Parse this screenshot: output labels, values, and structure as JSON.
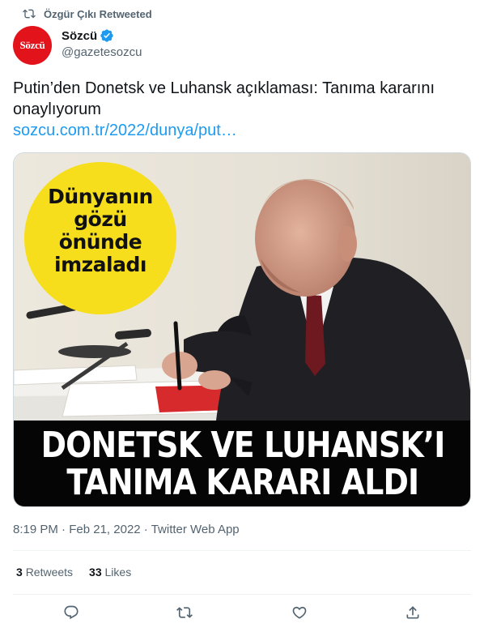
{
  "retweet_context": {
    "text": "Özgür Çıkı Retweeted",
    "icon": "retweet-icon"
  },
  "author": {
    "avatar_text": "Sözcü",
    "display_name": "Sözcü",
    "handle": "@gazetesozcu",
    "verified": true
  },
  "tweet": {
    "text": "Putin’den Donetsk ve Luhansk açıklaması: Tanıma kararını onaylıyorum",
    "link": "sozcu.com.tr/2022/dunya/put…"
  },
  "media": {
    "badge_lines": [
      "Dünyanın",
      "gözü",
      "önünde",
      "imzaladı"
    ],
    "banner_lines": [
      "DONETSK VE LUHANSK’I",
      "TANIMA KARARI ALDI"
    ]
  },
  "meta": {
    "time": "8:19 PM",
    "separator": "·",
    "date": "Feb 21, 2022",
    "source": "Twitter Web App"
  },
  "stats": {
    "retweets_count": "3",
    "retweets_label": "Retweets",
    "likes_count": "33",
    "likes_label": "Likes"
  },
  "colors": {
    "accent": "#1d9bf0",
    "brand_red": "#e3131b",
    "secondary_text": "#536471",
    "badge_yellow": "#f6de1c"
  },
  "actions": [
    "reply-icon",
    "retweet-icon",
    "like-icon",
    "share-icon"
  ]
}
